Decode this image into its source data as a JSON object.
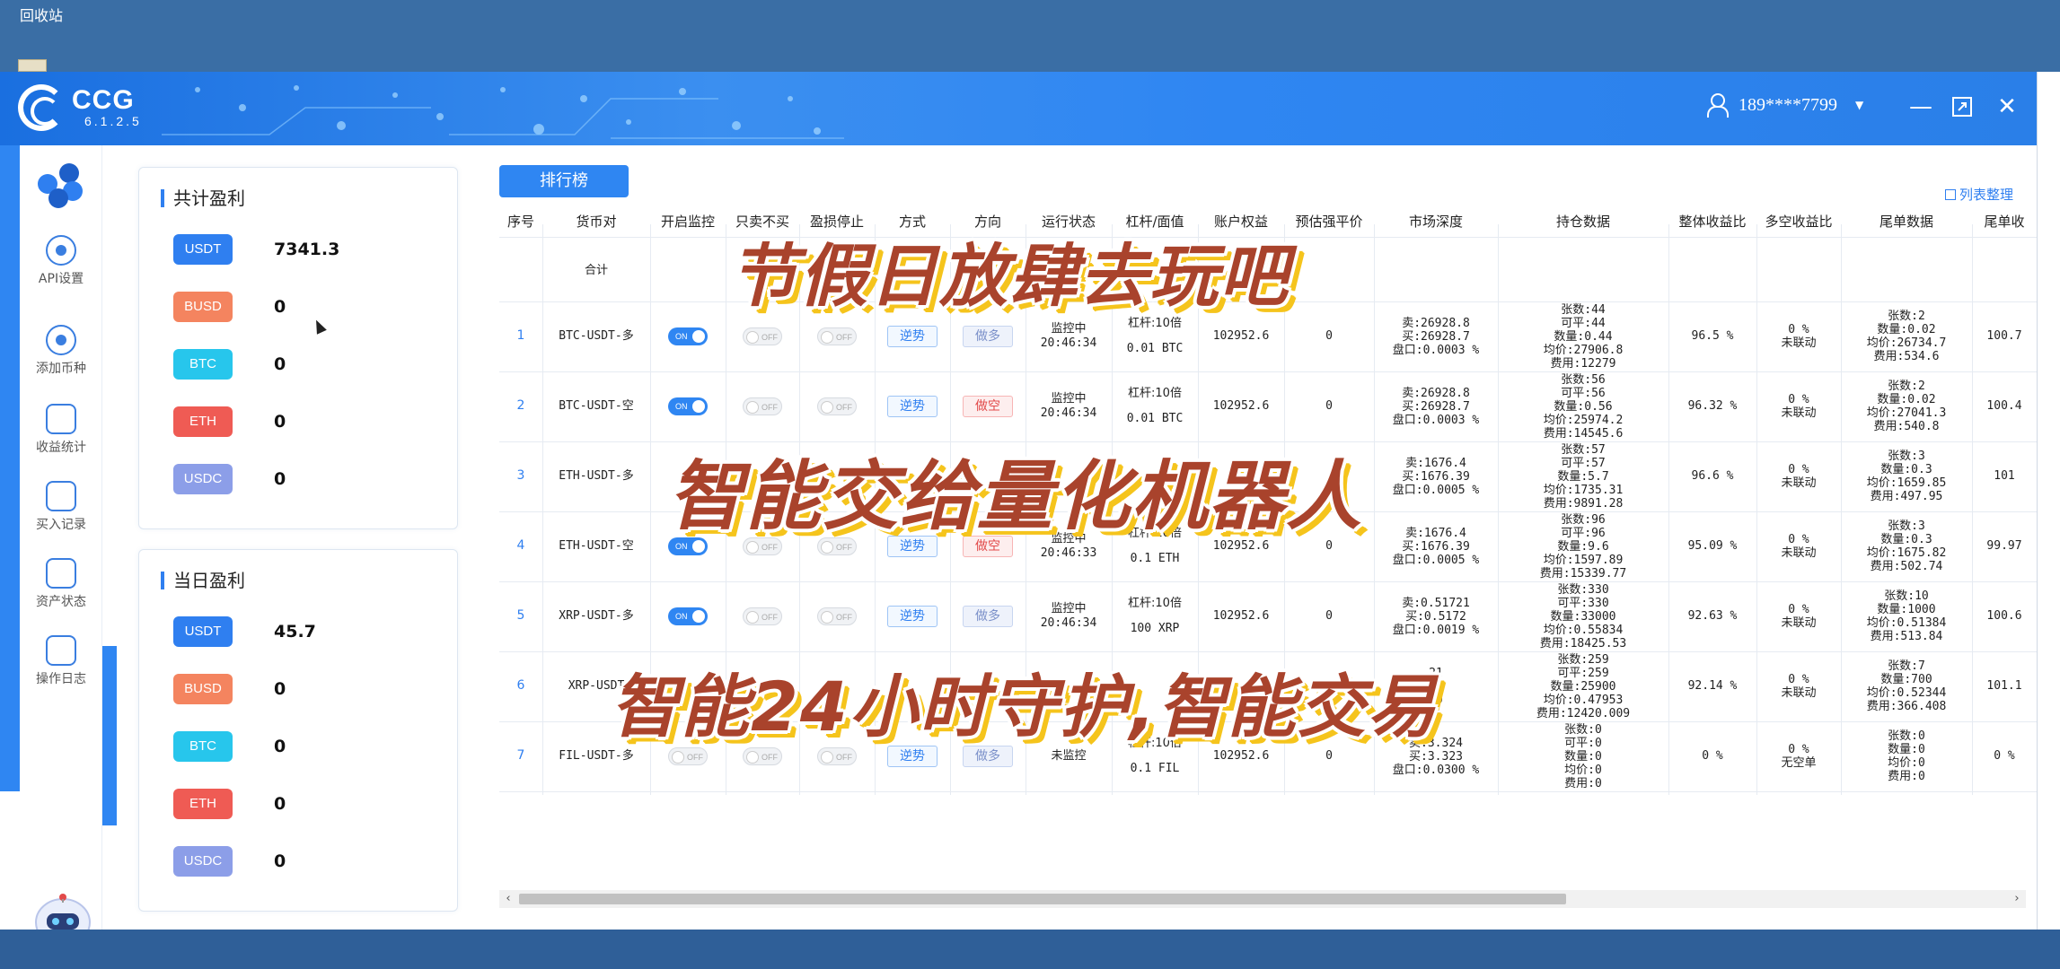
{
  "desktop": {
    "recycle_bin": "回收站"
  },
  "app": {
    "name": "CCG",
    "version": "6.1.2.5"
  },
  "user": {
    "account": "189****7799"
  },
  "nav": [
    {
      "label": "API设置",
      "icon": "gear-icon"
    },
    {
      "label": "添加币种",
      "icon": "add-coin-icon"
    },
    {
      "label": "收益统计",
      "icon": "chart-icon"
    },
    {
      "label": "买入记录",
      "icon": "record-icon"
    },
    {
      "label": "资产状态",
      "icon": "wallet-icon"
    },
    {
      "label": "操作日志",
      "icon": "log-icon"
    }
  ],
  "total_profit": {
    "title": "共计盈利",
    "coins": [
      {
        "name": "USDT",
        "value": "7341.3",
        "color": "#2f7ff0"
      },
      {
        "name": "BUSD",
        "value": "0",
        "color": "#f4845f"
      },
      {
        "name": "BTC",
        "value": "0",
        "color": "#27c6ec"
      },
      {
        "name": "ETH",
        "value": "0",
        "color": "#ef5b54"
      },
      {
        "name": "USDC",
        "value": "0",
        "color": "#8c9ee8"
      }
    ]
  },
  "daily_profit": {
    "title": "当日盈利",
    "coins": [
      {
        "name": "USDT",
        "value": "45.7",
        "color": "#2f7ff0"
      },
      {
        "name": "BUSD",
        "value": "0",
        "color": "#f4845f"
      },
      {
        "name": "BTC",
        "value": "0",
        "color": "#27c6ec"
      },
      {
        "name": "ETH",
        "value": "0",
        "color": "#ef5b54"
      },
      {
        "name": "USDC",
        "value": "0",
        "color": "#8c9ee8"
      }
    ]
  },
  "toolbar": {
    "rank_button": "排行榜",
    "list_sort": "列表整理"
  },
  "table": {
    "headers": [
      "序号",
      "货币对",
      "开启监控",
      "只卖不买",
      "盈损停止",
      "方式",
      "方向",
      "运行状态",
      "杠杆/面值",
      "账户权益",
      "预估强平价",
      "市场深度",
      "持仓数据",
      "整体收益比",
      "多空收益比",
      "尾单数据",
      "尾单收"
    ],
    "summary_label": "合计",
    "rows": [
      {
        "seq": "1",
        "pair": "BTC-USDT-多",
        "monitor": "ON",
        "sell_only": "OFF",
        "stop": "OFF",
        "mode": "逆势",
        "direction": "做多",
        "dir_style": "dl",
        "status1": "监控中",
        "status2": "20:46:34",
        "lev1": "杠杆:10倍",
        "lev2": "0.01 BTC",
        "equity": "102952.6",
        "liq": "0",
        "depth": [
          "卖:26928.8",
          "买:26928.7",
          "盘口:0.0003 %"
        ],
        "position": [
          "张数:44",
          "可平:44",
          "数量:0.44",
          "均价:27906.8",
          "费用:12279"
        ],
        "total_ratio": "96.5 %",
        "ls_ratio": [
          "0 %",
          "未联动"
        ],
        "tail": [
          "张数:2",
          "数量:0.02",
          "均价:26734.7",
          "费用:534.6"
        ],
        "tail_profit": "100.7"
      },
      {
        "seq": "2",
        "pair": "BTC-USDT-空",
        "monitor": "ON",
        "sell_only": "OFF",
        "stop": "OFF",
        "mode": "逆势",
        "direction": "做空",
        "dir_style": "red",
        "status1": "监控中",
        "status2": "20:46:34",
        "lev1": "杠杆:10倍",
        "lev2": "0.01 BTC",
        "equity": "102952.6",
        "liq": "0",
        "depth": [
          "卖:26928.8",
          "买:26928.7",
          "盘口:0.0003 %"
        ],
        "position": [
          "张数:56",
          "可平:56",
          "数量:0.56",
          "均价:25974.2",
          "费用:14545.6"
        ],
        "total_ratio": "96.32 %",
        "ls_ratio": [
          "0 %",
          "未联动"
        ],
        "tail": [
          "张数:2",
          "数量:0.02",
          "均价:27041.3",
          "费用:540.8"
        ],
        "tail_profit": "100.4"
      },
      {
        "seq": "3",
        "pair": "ETH-USDT-多",
        "monitor": "",
        "sell_only": "",
        "stop": "",
        "mode": "",
        "direction": "",
        "dir_style": "dl",
        "status1": "",
        "status2": "",
        "lev1": "",
        "lev2": "",
        "equity": "",
        "liq": "",
        "depth": [
          "卖:1676.4",
          "买:1676.39",
          "盘口:0.0005 %"
        ],
        "position": [
          "张数:57",
          "可平:57",
          "数量:5.7",
          "均价:1735.31",
          "费用:9891.28"
        ],
        "total_ratio": "96.6 %",
        "ls_ratio": [
          "0 %",
          "未联动"
        ],
        "tail": [
          "张数:3",
          "数量:0.3",
          "均价:1659.85",
          "费用:497.95"
        ],
        "tail_profit": "101"
      },
      {
        "seq": "4",
        "pair": "ETH-USDT-空",
        "monitor": "ON",
        "sell_only": "OFF",
        "stop": "OFF",
        "mode": "逆势",
        "direction": "做空",
        "dir_style": "red",
        "status1": "监控中",
        "status2": "20:46:33",
        "lev1": "杠杆:10倍",
        "lev2": "0.1 ETH",
        "equity": "102952.6",
        "liq": "0",
        "depth": [
          "卖:1676.4",
          "买:1676.39",
          "盘口:0.0005 %"
        ],
        "position": [
          "张数:96",
          "可平:96",
          "数量:9.6",
          "均价:1597.89",
          "费用:15339.77"
        ],
        "total_ratio": "95.09 %",
        "ls_ratio": [
          "0 %",
          "未联动"
        ],
        "tail": [
          "张数:3",
          "数量:0.3",
          "均价:1675.82",
          "费用:502.74"
        ],
        "tail_profit": "99.97"
      },
      {
        "seq": "5",
        "pair": "XRP-USDT-多",
        "monitor": "ON",
        "sell_only": "OFF",
        "stop": "OFF",
        "mode": "逆势",
        "direction": "做多",
        "dir_style": "dl",
        "status1": "监控中",
        "status2": "20:46:34",
        "lev1": "杠杆:10倍",
        "lev2": "100 XRP",
        "equity": "102952.6",
        "liq": "0",
        "depth": [
          "卖:0.51721",
          "买:0.5172",
          "盘口:0.0019 %"
        ],
        "position": [
          "张数:330",
          "可平:330",
          "数量:33000",
          "均价:0.55834",
          "费用:18425.53"
        ],
        "total_ratio": "92.63 %",
        "ls_ratio": [
          "0 %",
          "未联动"
        ],
        "tail": [
          "张数:10",
          "数量:1000",
          "均价:0.51384",
          "费用:513.84"
        ],
        "tail_profit": "100.6"
      },
      {
        "seq": "6",
        "pair": "XRP-USDT",
        "monitor": "",
        "sell_only": "",
        "stop": "",
        "mode": "",
        "direction": "",
        "dir_style": "dl",
        "status1": "",
        "status2": "",
        "lev1": "",
        "lev2": "",
        "equity": "",
        "liq": "",
        "depth": [
          "21",
          "72",
          "19"
        ],
        "position": [
          "张数:259",
          "可平:259",
          "数量:25900",
          "均价:0.47953",
          "费用:12420.009"
        ],
        "total_ratio": "92.14 %",
        "ls_ratio": [
          "0 %",
          "未联动"
        ],
        "tail": [
          "张数:7",
          "数量:700",
          "均价:0.52344",
          "费用:366.408"
        ],
        "tail_profit": "101.1"
      },
      {
        "seq": "7",
        "pair": "FIL-USDT-多",
        "monitor": "OFF",
        "sell_only": "OFF",
        "stop": "OFF",
        "mode": "逆势",
        "direction": "做多",
        "dir_style": "dl",
        "status1": "未监控",
        "status2": "",
        "lev1": "杠杆:10倍",
        "lev2": "0.1 FIL",
        "equity": "102952.6",
        "liq": "0",
        "depth": [
          "卖:3.324",
          "买:3.323",
          "盘口:0.0300 %"
        ],
        "position": [
          "张数:0",
          "可平:0",
          "数量:0",
          "均价:0",
          "费用:0"
        ],
        "total_ratio": "0 %",
        "ls_ratio": [
          "0 %",
          "无空单"
        ],
        "tail": [
          "张数:0",
          "数量:0",
          "均价:0",
          "费用:0"
        ],
        "tail_profit": "0 %"
      }
    ]
  },
  "overlay": {
    "line1": "节假日放肆去玩吧",
    "line2": "智能交给量化机器人",
    "line3": "智能24小时守护,智能交易"
  }
}
